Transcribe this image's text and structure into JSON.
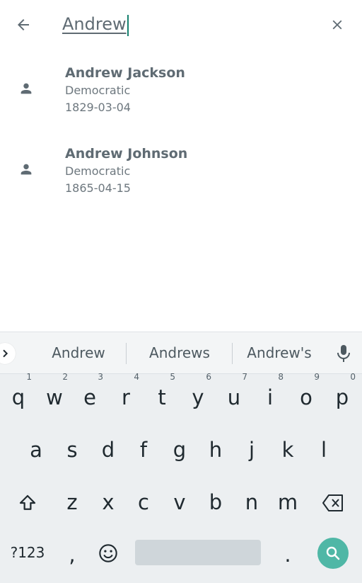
{
  "search": {
    "query": "Andrew"
  },
  "results": [
    {
      "name": "Andrew Jackson",
      "party": "Democratic",
      "date": "1829-03-04"
    },
    {
      "name": "Andrew Johnson",
      "party": "Democratic",
      "date": "1865-04-15"
    }
  ],
  "keyboard": {
    "suggestions": [
      "Andrew",
      "Andrews",
      "Andrew's"
    ],
    "row1": [
      {
        "key": "q",
        "hint": "1"
      },
      {
        "key": "w",
        "hint": "2"
      },
      {
        "key": "e",
        "hint": "3"
      },
      {
        "key": "r",
        "hint": "4"
      },
      {
        "key": "t",
        "hint": "5"
      },
      {
        "key": "y",
        "hint": "6"
      },
      {
        "key": "u",
        "hint": "7"
      },
      {
        "key": "i",
        "hint": "8"
      },
      {
        "key": "o",
        "hint": "9"
      },
      {
        "key": "p",
        "hint": "0"
      }
    ],
    "row2": [
      "a",
      "s",
      "d",
      "f",
      "g",
      "h",
      "j",
      "k",
      "l"
    ],
    "row3": [
      "z",
      "x",
      "c",
      "v",
      "b",
      "n",
      "m"
    ],
    "symbols_label": "?123",
    "comma_label": ",",
    "period_label": "."
  },
  "colors": {
    "accent": "#4fb7a6",
    "caret": "#16806f",
    "text": "#5f6b73"
  }
}
